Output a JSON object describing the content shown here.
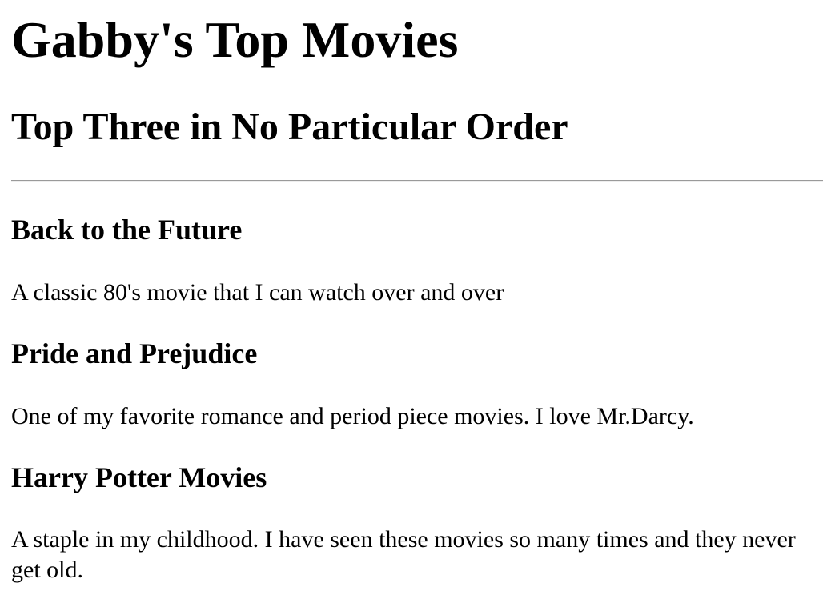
{
  "page": {
    "title": "Gabby's Top Movies",
    "subtitle": "Top Three in No Particular Order"
  },
  "movies": [
    {
      "title": "Back to the Future",
      "description": "A classic 80's movie that I can watch over and over"
    },
    {
      "title": "Pride and Prejudice",
      "description": "One of my favorite romance and period piece movies. I love Mr.Darcy."
    },
    {
      "title": "Harry Potter Movies",
      "description": "A staple in my childhood. I have seen these movies so many times and they never get old."
    }
  ]
}
